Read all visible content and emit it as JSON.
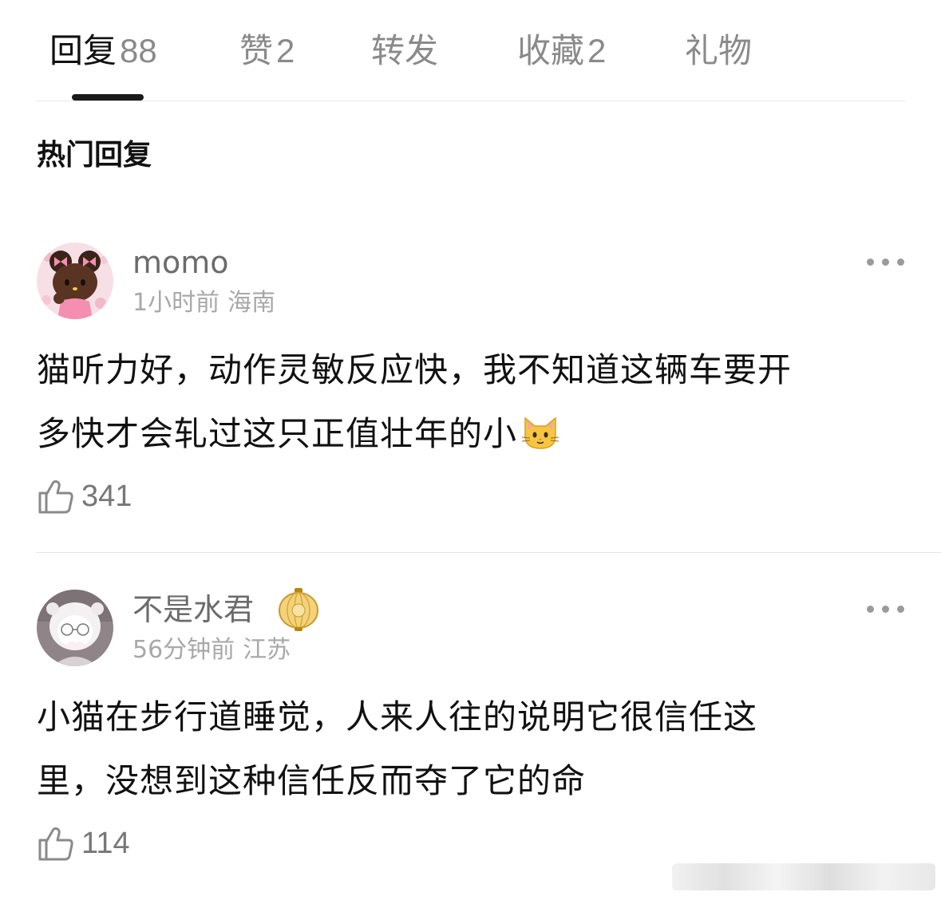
{
  "tabs": [
    {
      "label": "回复",
      "count": "88"
    },
    {
      "label": "赞",
      "count": "2"
    },
    {
      "label": "转发",
      "count": ""
    },
    {
      "label": "收藏",
      "count": "2"
    },
    {
      "label": "礼物",
      "count": ""
    }
  ],
  "active_tab": "回复",
  "section_title": "热门回复",
  "comments": [
    {
      "username": "momo",
      "time": "1小时前",
      "location": "海南",
      "text_line1": "猫听力好，动作灵敏反应快，我不知道这辆车要开",
      "text_line2": "多快才会轧过这只正值壮年的小",
      "emoji": "cat-face",
      "likes": "341"
    },
    {
      "username": "不是水君",
      "badge": "golden-lantern",
      "time": "56分钟前",
      "location": "江苏",
      "text_line1": "小猫在步行道睡觉，人来人往的说明它很信任这",
      "text_line2": "里，没想到这种信任反而夺了它的命",
      "likes": "114"
    }
  ],
  "colors": {
    "primary_text": "#111111",
    "secondary_text": "#8a8a8a",
    "meta_text": "#a8a8a8",
    "divider": "#e6e6e6",
    "indicator": "#1a1a1a"
  }
}
